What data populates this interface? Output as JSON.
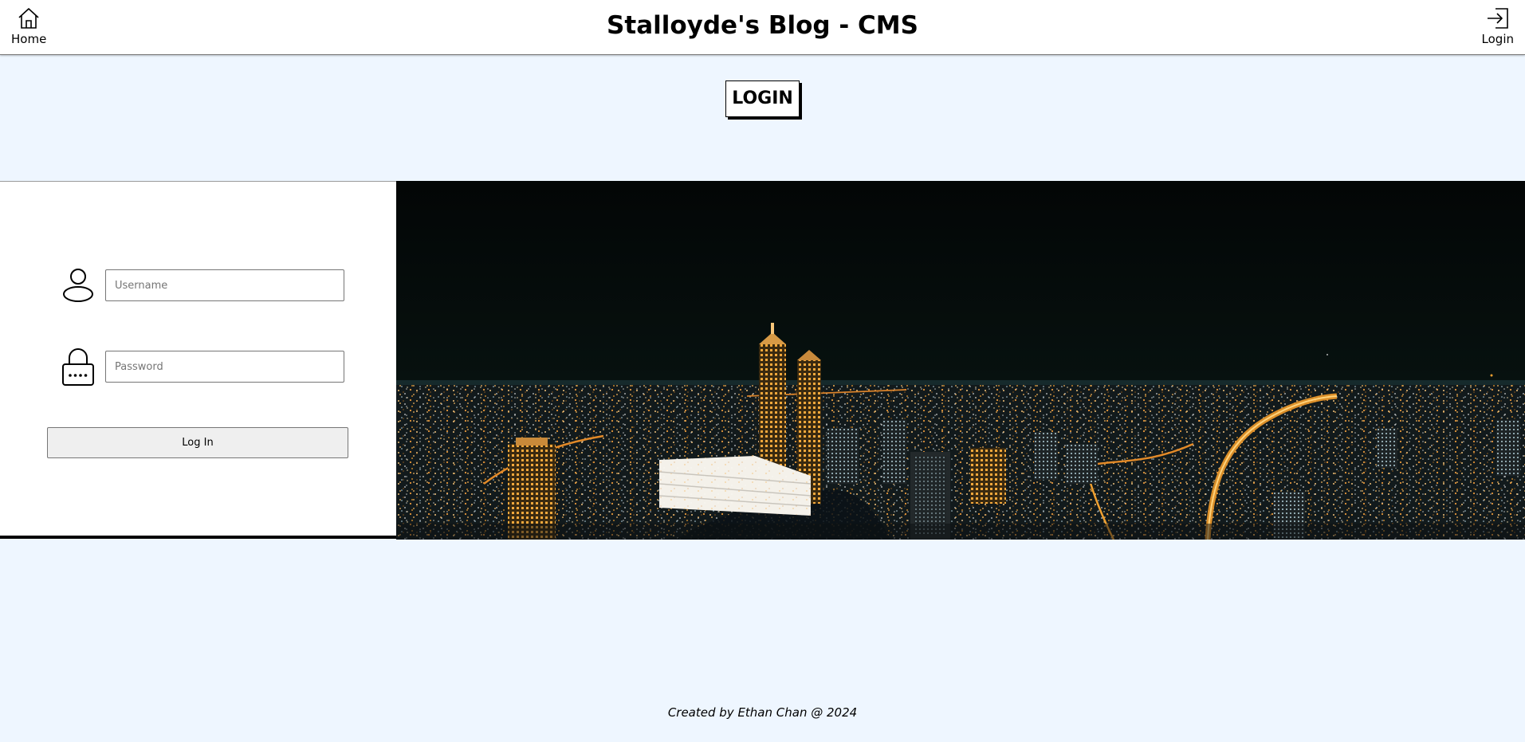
{
  "header": {
    "title": "Stalloyde's Blog - CMS",
    "home_label": "Home",
    "login_label": "Login",
    "home_icon": "home-icon",
    "login_icon": "sign-in-icon"
  },
  "page": {
    "heading": "LOGIN"
  },
  "login_form": {
    "username_placeholder": "Username",
    "username_value": "",
    "password_placeholder": "Password",
    "password_value": "",
    "submit_label": "Log In",
    "username_icon": "user-icon",
    "password_icon": "lock-icon"
  },
  "hero": {
    "image": "night-city-skyline"
  },
  "footer": {
    "credit": "Created by Ethan Chan @ 2024"
  },
  "colors": {
    "page_background": "#eef6ff",
    "header_background": "#ffffff",
    "panel_background": "#ffffff",
    "button_background": "#efefef",
    "city_lights": "#f0a030"
  }
}
